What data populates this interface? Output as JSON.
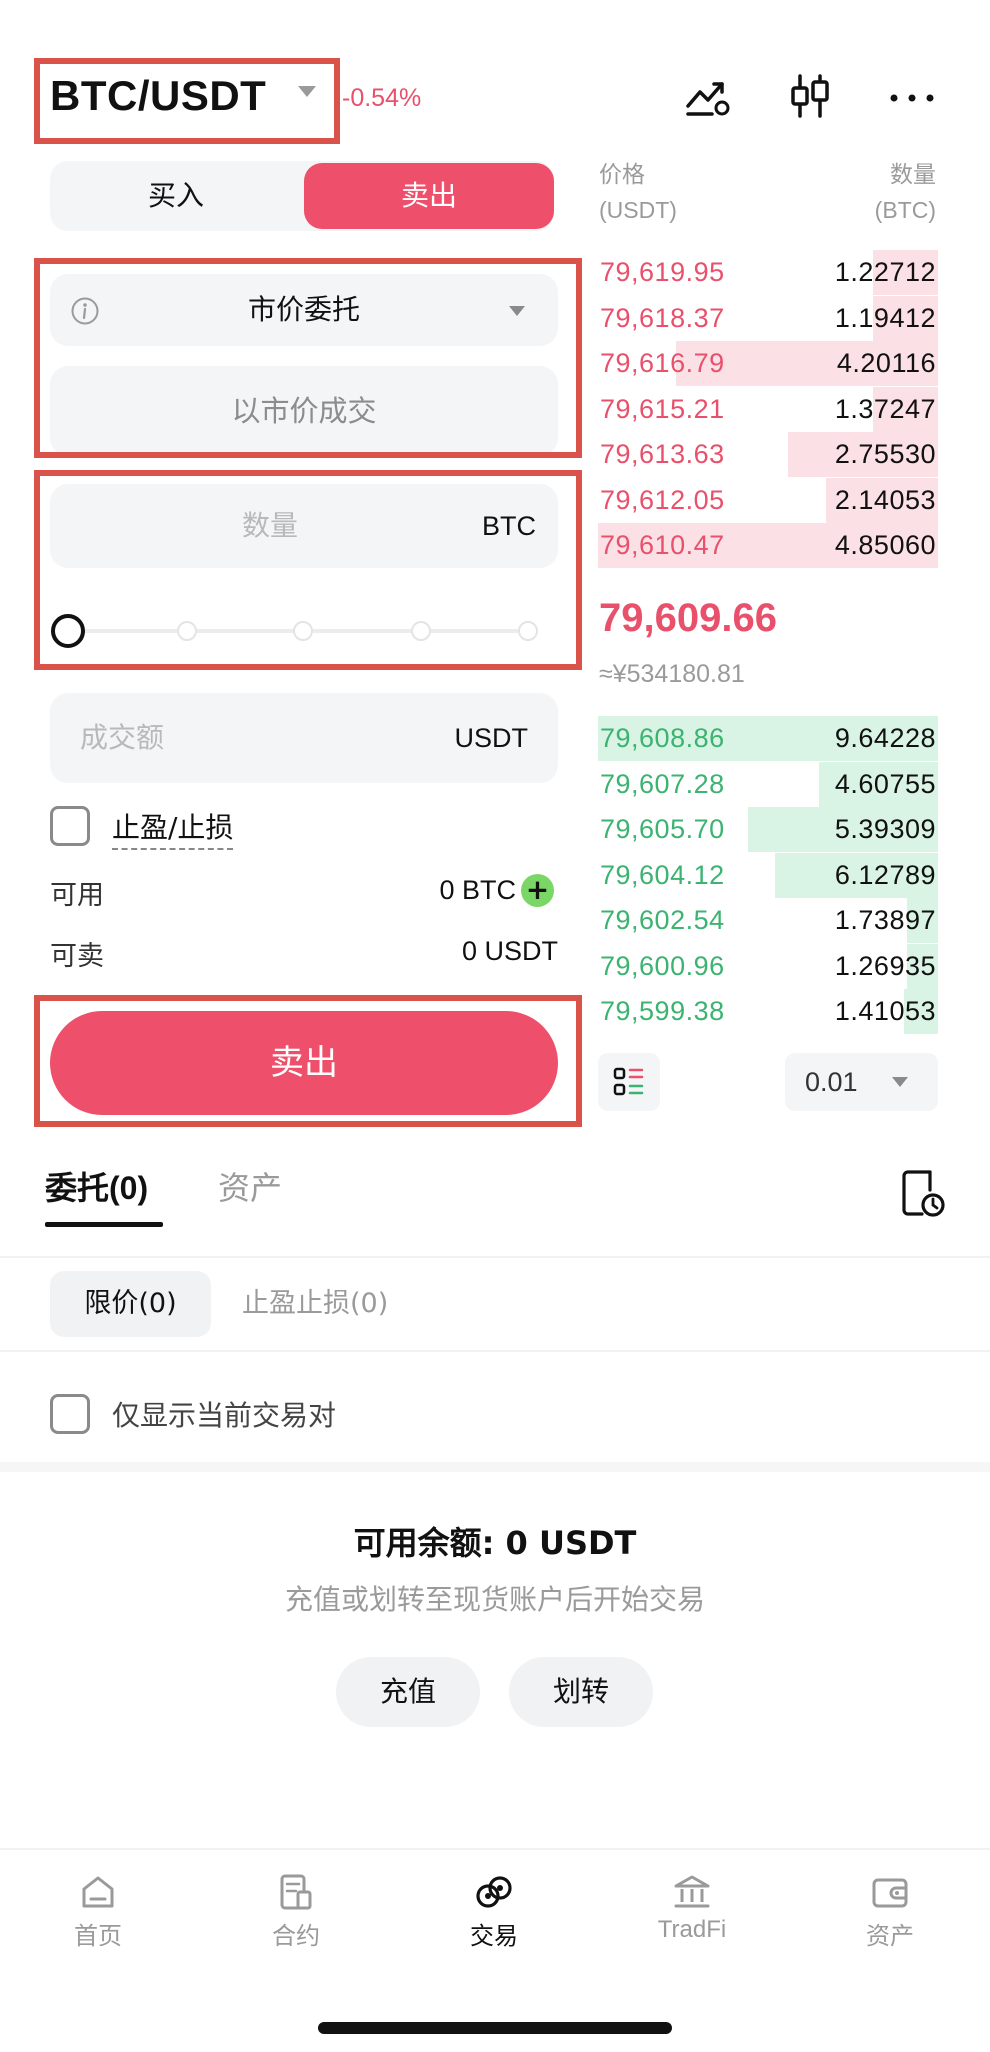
{
  "header": {
    "pair": "BTC/USDT",
    "change": "-0.54%",
    "icons": [
      "chart-analysis-icon",
      "candlestick-icon",
      "more-icon"
    ]
  },
  "trade_form": {
    "tab_buy": "买入",
    "tab_sell": "卖出",
    "order_type": "市价委托",
    "market_price_text": "以市价成交",
    "quantity_placeholder": "数量",
    "quantity_unit": "BTC",
    "slider_value": 0,
    "amount_placeholder": "成交额",
    "amount_unit": "USDT",
    "tpsl_label": "止盈/止损",
    "available_label": "可用",
    "available_value": "0 BTC",
    "sellable_label": "可卖",
    "sellable_value": "0 USDT",
    "submit_label": "卖出"
  },
  "order_book": {
    "price_header": "价格",
    "price_unit": "(USDT)",
    "size_header": "数量",
    "size_unit": "(BTC)",
    "asks": [
      {
        "price": "79,619.95",
        "size": "1.22712",
        "depth": 0.19
      },
      {
        "price": "79,618.37",
        "size": "1.19412",
        "depth": 0.19
      },
      {
        "price": "79,616.79",
        "size": "4.20116",
        "depth": 0.77
      },
      {
        "price": "79,615.21",
        "size": "1.37247",
        "depth": 0.19
      },
      {
        "price": "79,613.63",
        "size": "2.75530",
        "depth": 0.44
      },
      {
        "price": "79,612.05",
        "size": "2.14053",
        "depth": 0.33
      },
      {
        "price": "79,610.47",
        "size": "4.85060",
        "depth": 1.0
      }
    ],
    "last_price": "79,609.66",
    "last_price_cny": "≈¥534180.81",
    "bids": [
      {
        "price": "79,608.86",
        "size": "9.64228",
        "depth": 1.0
      },
      {
        "price": "79,607.28",
        "size": "4.60755",
        "depth": 0.35
      },
      {
        "price": "79,605.70",
        "size": "5.39309",
        "depth": 0.56
      },
      {
        "price": "79,604.12",
        "size": "6.12789",
        "depth": 0.48
      },
      {
        "price": "79,602.54",
        "size": "1.73897",
        "depth": 0.09
      },
      {
        "price": "79,600.96",
        "size": "1.26935",
        "depth": 0.09
      },
      {
        "price": "79,599.38",
        "size": "1.41053",
        "depth": 0.1
      }
    ],
    "precision": "0.01",
    "colors": {
      "ask": "#e8506b",
      "bid": "#3cb371",
      "ask_bg": "#fbe0e5",
      "bid_bg": "#d9f3e4"
    }
  },
  "orders": {
    "tab_active": "委托(0)",
    "tab_assets": "资产",
    "chip_limit": "限价(0)",
    "chip_tpsl": "止盈止损(0)",
    "only_current_pair": "仅显示当前交易对",
    "balance_title": "可用余额: 0 USDT",
    "balance_sub": "充值或划转至现货账户后开始交易",
    "deposit_label": "充值",
    "transfer_label": "划转"
  },
  "bottom_nav": {
    "items": [
      {
        "label": "首页",
        "icon": "home-icon"
      },
      {
        "label": "合约",
        "icon": "futures-icon"
      },
      {
        "label": "交易",
        "icon": "trade-icon"
      },
      {
        "label": "TradFi",
        "icon": "bank-icon"
      },
      {
        "label": "资产",
        "icon": "wallet-icon"
      }
    ],
    "active": "交易"
  }
}
